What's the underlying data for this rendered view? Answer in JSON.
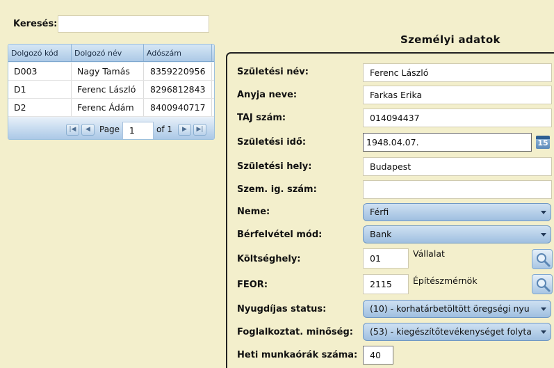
{
  "search": {
    "label": "Keresés:",
    "value": ""
  },
  "grid": {
    "columns": [
      "Dolgozó kód",
      "Dolgozó név",
      "Adószám"
    ],
    "rows": [
      [
        "D003",
        "Nagy Tamás",
        "8359220956"
      ],
      [
        "D1",
        "Ferenc László",
        "8296812843"
      ],
      [
        "D2",
        "Ferenc Ádám",
        "8400940717"
      ]
    ],
    "pager": {
      "page_label": "Page",
      "page_value": "1",
      "of_label": "of 1"
    }
  },
  "panel": {
    "title": "Személyi adatok",
    "fields": {
      "szuletesi_nev": {
        "label": "Születési név:",
        "value": "Ferenc László"
      },
      "anyja_neve": {
        "label": "Anyja neve:",
        "value": "Farkas Erika"
      },
      "taj_szam": {
        "label": "TAJ szám:",
        "value": "014094437"
      },
      "szuletesi_ido": {
        "label": "Születési idő:",
        "value": "1948.04.07.",
        "calendar_icon_text": "15"
      },
      "szuletesi_hely": {
        "label": "Születési hely:",
        "value": "Budapest"
      },
      "szem_ig_szam": {
        "label": "Szem. ig. szám:",
        "value": ""
      },
      "neme": {
        "label": "Neme:",
        "value": "Férfi"
      },
      "berfelvetel_mod": {
        "label": "Bérfelvétel mód:",
        "value": "Bank"
      },
      "koltseghely": {
        "label": "Költséghely:",
        "value": "01",
        "description": "Vállalat"
      },
      "feor": {
        "label": "FEOR:",
        "value": "2115",
        "description": "Építészmérnök"
      },
      "nyugdijas_status": {
        "label": "Nyugdíjas status:",
        "value": "(10) - korhatárbetöltött öregségi nyu"
      },
      "foglalkoztat_minoseg": {
        "label": "Foglalkoztat. minőség:",
        "value": "(53) - kiegészítőtevékenységet folyta"
      },
      "heti_munkaorak": {
        "label": "Heti munkaórák száma:",
        "value": "40"
      }
    }
  },
  "icons": {
    "first_page": "first-page-icon",
    "prev_page": "prev-page-icon",
    "next_page": "next-page-icon",
    "last_page": "last-page-icon",
    "calendar": "calendar-icon",
    "lookup": "magnifier-icon",
    "dropdown": "chevron-down-icon"
  },
  "colors": {
    "background": "#f3efcc",
    "grid_header": "#acc9e6",
    "select_fill": "#9fbfe0"
  }
}
